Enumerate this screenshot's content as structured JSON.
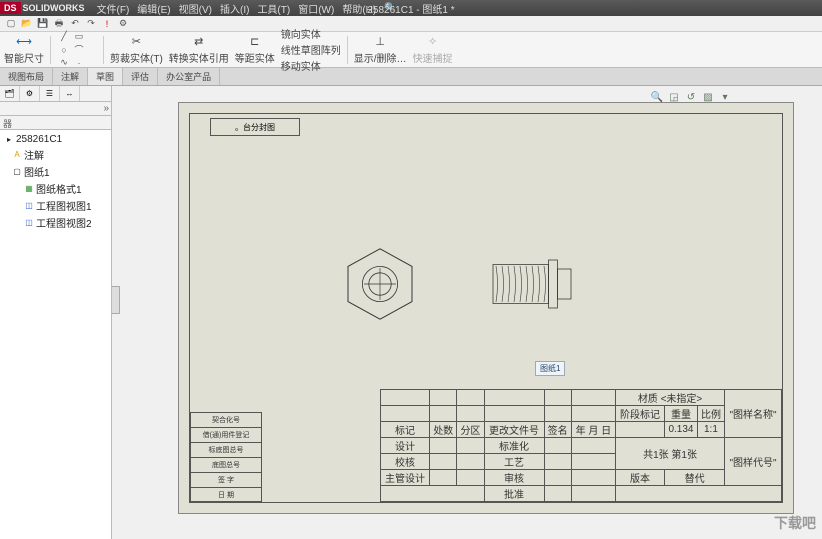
{
  "app": {
    "brand": "SOLIDWORKS",
    "doc_title": "258261C1 - 图纸1 *"
  },
  "menu": [
    "文件(F)",
    "编辑(E)",
    "视图(V)",
    "插入(I)",
    "工具(T)",
    "窗口(W)",
    "帮助(H)"
  ],
  "ribbon": {
    "smart_dim": "智能尺寸",
    "trim": "剪裁实体(T)",
    "convert": "转换实体引用",
    "offset": "等距实体",
    "mirror": "镜向实体",
    "linear_pattern": "线性草图阵列",
    "move": "移动实体",
    "show_delete": "显示/删除…",
    "quick_snap": "快速捕捉"
  },
  "tabs": [
    "视图布局",
    "注解",
    "草图",
    "评估",
    "办公室产品"
  ],
  "side": {
    "filter": "器"
  },
  "tree": {
    "root": "258261C1",
    "anno": "注解",
    "sheet": "图纸1",
    "fmt": "图纸格式1",
    "dv1": "工程图视图1",
    "dv2": "工程图视图2"
  },
  "drawing": {
    "title_box": "。台分封图",
    "view_tag": "图纸1",
    "left_labels": [
      "契合化号",
      "借(通)用件登记",
      "标底图总号",
      "底图总号",
      "签  字",
      "日  期"
    ],
    "tb": {
      "mat": "材质 <未指定>",
      "r1": [
        "标记",
        "处数",
        "分区",
        "更改文件号",
        "签名",
        "年 月 日"
      ],
      "r2a": "设计",
      "r2b": "标准化",
      "r3a": "校核",
      "r3b": "工艺",
      "r4a": "主管设计",
      "r4b": "审核",
      "r5b": "批准",
      "stage": "阶段标记",
      "weight": "重量",
      "scale": "比例",
      "wv": "0.134",
      "sv": "1:1",
      "gm": "共1张 第1张",
      "ver": "版本",
      "rep": "替代",
      "pn": "\"图样名称\"",
      "pc": "\"图样代号\""
    }
  },
  "watermark": "下载吧"
}
